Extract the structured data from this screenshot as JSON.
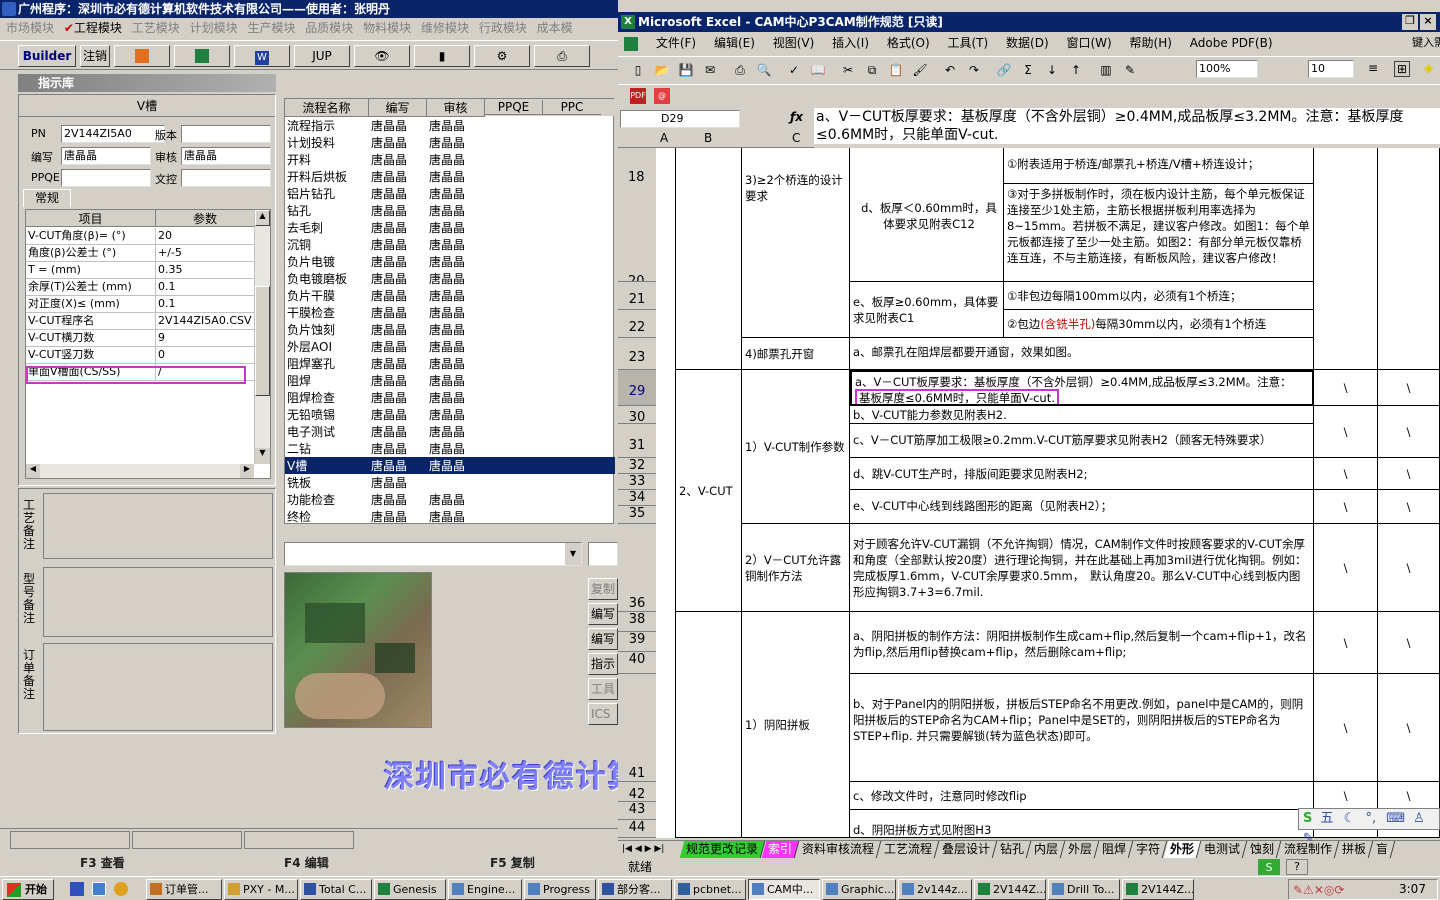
{
  "left_app": {
    "title": "广州程序：深圳市必有德计算机软件技术有限公司——使用者：张明丹",
    "menu": [
      "市场模块",
      "工程模块",
      "工艺模块",
      "计划模块",
      "生产模块",
      "品质模块",
      "物料模块",
      "维修模块",
      "行政模块",
      "成本模"
    ],
    "toolbar": {
      "builder": "Builder",
      "logout": "注销",
      "jup": "JUP"
    },
    "knowledge_header": "指示库",
    "v_groove": "V槽",
    "fields": {
      "pn_label": "PN",
      "pn_value": "2V144ZI5A0",
      "version_label": "版本",
      "writer_label": "编写",
      "writer_value": "唐晶晶",
      "reviewer_label": "审核",
      "reviewer_value": "唐晶晶",
      "ppqe_label": "PPQE",
      "control_label": "文控"
    },
    "tab_general": "常规",
    "param_headers": [
      "项目",
      "参数"
    ],
    "params": [
      [
        "V-CUT角度(β)= (°)",
        "20"
      ],
      [
        "角度(β)公差士 (°)",
        "+/-5"
      ],
      [
        "T = (mm)",
        "0.35"
      ],
      [
        "余厚(T)公差士 (mm)",
        "0.1"
      ],
      [
        "对正度(X)≤ (mm)",
        "0.1"
      ],
      [
        "V-CUT程序名",
        "2V144ZI5A0.CSV"
      ],
      [
        "V-CUT横刀数",
        "9"
      ],
      [
        "V-CUT竖刀数",
        "0"
      ],
      [
        "单面V槽面(CS/SS)",
        "/"
      ]
    ],
    "notes": [
      "工艺备注",
      "型号备注",
      "订单备注"
    ],
    "process_headers": [
      "流程名称",
      "编写",
      "审核",
      "PPQE",
      "PPC"
    ],
    "processes": [
      [
        "流程指示",
        "唐晶晶",
        "唐晶晶"
      ],
      [
        "计划投料",
        "唐晶晶",
        "唐晶晶"
      ],
      [
        "开料",
        "唐晶晶",
        "唐晶晶"
      ],
      [
        "开料后烘板",
        "唐晶晶",
        "唐晶晶"
      ],
      [
        "铝片钻孔",
        "唐晶晶",
        "唐晶晶"
      ],
      [
        "钻孔",
        "唐晶晶",
        "唐晶晶"
      ],
      [
        "去毛刺",
        "唐晶晶",
        "唐晶晶"
      ],
      [
        "沉铜",
        "唐晶晶",
        "唐晶晶"
      ],
      [
        "负片电镀",
        "唐晶晶",
        "唐晶晶"
      ],
      [
        "负电镀磨板",
        "唐晶晶",
        "唐晶晶"
      ],
      [
        "负片干膜",
        "唐晶晶",
        "唐晶晶"
      ],
      [
        "干膜检查",
        "唐晶晶",
        "唐晶晶"
      ],
      [
        "负片蚀刻",
        "唐晶晶",
        "唐晶晶"
      ],
      [
        "外层AOI",
        "唐晶晶",
        "唐晶晶"
      ],
      [
        "阻焊塞孔",
        "唐晶晶",
        "唐晶晶"
      ],
      [
        "阻焊",
        "唐晶晶",
        "唐晶晶"
      ],
      [
        "阻焊检查",
        "唐晶晶",
        "唐晶晶"
      ],
      [
        "无铅喷锡",
        "唐晶晶",
        "唐晶晶"
      ],
      [
        "电子测试",
        "唐晶晶",
        "唐晶晶"
      ],
      [
        "二钻",
        "唐晶晶",
        "唐晶晶"
      ],
      [
        "V槽",
        "唐晶晶",
        "唐晶晶"
      ],
      [
        "铣板",
        "唐晶晶",
        ""
      ],
      [
        "功能检查",
        "唐晶晶",
        "唐晶晶"
      ],
      [
        "终检",
        "唐晶晶",
        "唐晶晶"
      ]
    ],
    "side_buttons": [
      "复制",
      "编写",
      "编写",
      "指示",
      "工具",
      "ICS"
    ],
    "banner": "深圳市必有德计算机",
    "fkeys": [
      "F3 查看",
      "F4 编辑",
      "F5 复制"
    ]
  },
  "excel": {
    "title": "Microsoft Excel - CAM中心P3CAM制作规范 [只读]",
    "menu": [
      "文件(F)",
      "编辑(E)",
      "视图(V)",
      "插入(I)",
      "格式(O)",
      "工具(T)",
      "数据(D)",
      "窗口(W)",
      "帮助(H)",
      "Adobe PDF(B)"
    ],
    "help_box": "键入需要",
    "zoom": "100%",
    "font_size": "10",
    "name_box": "D29",
    "formula": "a、V－CUT板厚要求：基板厚度（不含外层铜）≥0.4MM,成品板厚≤3.2MM。注意：基板厚度≤0.6MM时，只能单面V-cut.",
    "col_headers": [
      "A",
      "B",
      "C"
    ],
    "row_numbers": [
      "18",
      "20",
      "21",
      "22",
      "23",
      "29",
      "30",
      "31",
      "32",
      "33",
      "34",
      "35",
      "36",
      "38",
      "39",
      "40",
      "41",
      "42",
      "43",
      "44"
    ],
    "cells": {
      "bridge": "3)≥2个桥连的设计要求",
      "d_thin": "d、板厚＜0.60mm时，具体要求见附表C12",
      "e_thick": "e、板厚≥0.60mm，具体要求见附表C1",
      "note1": "①附表适用于桥连/邮票孔+桥连/V槽+桥连设计；",
      "note3": "③对于多拼板制作时，须在板内设计主筋，每个单元板保证连接至少1处主筋，主筋长根据拼板利用率选择为8~15mm。若拼板不满足，建议客户修改。如图1：每个单元板都连接了至少一处主筋。如图2：有部分单元板仅靠桥连互连，不与主筋连接，有断板风险，建议客户修改！",
      "note_r1": "①非包边每隔100mm以内，必须有1个桥连；",
      "note_r2a": "②包边",
      "note_r2b": "(含铣半孔)",
      "note_r2c": "每隔30mm以内，必须有1个桥连",
      "stamp": "4)邮票孔开窗",
      "stamp_a": "a、邮票孔在阻焊层都要开通窗，效果如图。",
      "vcut": "2、V-CUT",
      "vcut1": "1）V-CUT制作参数",
      "vcut_a1": "a、V－CUT板厚要求：基板厚度（不含外层铜）≥0.4MM,成品板厚≤3.2MM。注意：",
      "vcut_a2": "基板厚度≤0.6MM时，只能单面V-cut.",
      "vcut_b": "b、V-CUT能力参数见附表H2.",
      "vcut_c": "c、V－CUT筋厚加工极限≥0.2mm.V-CUT筋厚要求见附表H2（顾客无特殊要求）",
      "vcut_d": "d、跳V-CUT生产时，排版间距要求见附表H2;",
      "vcut_e": "e、V-CUT中心线到线路图形的距离（见附表H2）；",
      "vcut2": "2）V－CUT允许露铜制作方法",
      "vcut2_text": "对于顾客允许V-CUT漏铜（不允许掏铜）情况，CAM制作文件时按顾客要求的V-CUT余厚和角度（全部默认按20度）进行理论掏铜，并在此基础上再加3mil进行优化掏铜。例如：　完成板厚1.6mm，V-CUT余厚要求0.5mm，　默认角度20。那么V-CUT中心线到板内图形应掏铜3.7+3=6.7mil.",
      "yinyang": "1）阴阳拼板",
      "yy_a": "a、阴阳拼板的制作方法：阴阳拼板制作生成cam+flip,然后复制一个cam+flip+1，改名为flip,然后用flip替换cam+flip，然后删除cam+flip;",
      "yy_b": "b、对于Panel内的阴阳拼板，拼板后STEP命名不用更改.例如，panel中是CAM的，则阴阳拼板后的STEP命名为CAM+flip；Panel中是SET的，则阴阳拼板后的STEP命名为STEP+flip. 并只需要解锁(转为蓝色状态)即可。",
      "yy_c": "c、修改文件时，注意同时修改flip",
      "yy_d": "d、阴阳拼板方式见附图H3",
      "slash": "\\"
    },
    "sheet_tabs": [
      "规范更改记录",
      "索引",
      "资料审核流程",
      "工艺流程",
      "叠层设计",
      "钻孔",
      "内层",
      "外层",
      "阻焊",
      "字符",
      "外形",
      "电测试",
      "蚀刻",
      "流程制作",
      "拼板",
      "盲"
    ],
    "status": "就绪",
    "ime": "五"
  },
  "taskbar": {
    "start": "开始",
    "tasks": [
      "订单管...",
      "PXY - M...",
      "Total C...",
      "Genesis",
      "Engine...",
      "Progress",
      "部分客...",
      "pcbnet...",
      "CAM中...",
      "Graphic...",
      "2v144z...",
      "2V144Z...",
      "Drill To...",
      "2V144Z..."
    ],
    "clock": "3:07"
  },
  "colors": {
    "title_bar": "#0a246a",
    "highlight": "#cc33cc",
    "selection": "#0a246a",
    "tab_green": "#33cc33",
    "tab_magenta": "#ff33ff"
  }
}
